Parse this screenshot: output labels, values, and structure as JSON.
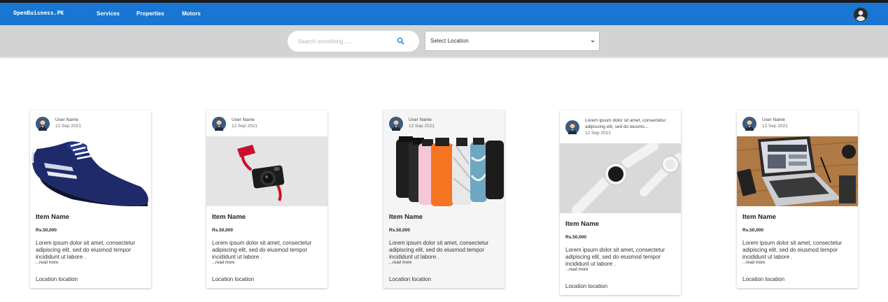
{
  "navbar": {
    "brand": "OpenBuisness.PK",
    "links": [
      "Services",
      "Properties",
      "Motors"
    ]
  },
  "search": {
    "placeholder": "Search something......",
    "location_placeholder": "Select Location"
  },
  "cards": [
    {
      "user": "User Name",
      "date": "12 Sep 2021",
      "image": "shoe",
      "title": "Item Name",
      "price": "Rs.50,000",
      "description": "Lorem ipsum dolor sit amet, consectetur adipiscing elit, sed do eiusmod tempor incididunt ut labore .",
      "read_more": "...read more",
      "location": "Location location"
    },
    {
      "user": "User Name",
      "date": "12 Sep 2021",
      "image": "camera",
      "title": "Item Name",
      "price": "Rs.50,000",
      "description": "Lorem ipsum dolor sit amet, consectetur adipiscing elit, sed do eiusmod tempor incididunt ut labore .",
      "read_more": "...read more",
      "location": "Location location"
    },
    {
      "user": "User Name",
      "date": "12 Sep 2021",
      "image": "bottles",
      "title": "Item Name",
      "price": "Rs.50,000",
      "description": "Lorem ipsum dolor sit amet, consectetur adipiscing elit, sed do eiusmod tempor incididunt ut labore .",
      "read_more": "...read more",
      "location": "Location location"
    },
    {
      "user": "Lorem ipsum dolor sit amet, consectetur adipiscing elit, sed do eiusmo...",
      "date": "12 Sep 2021",
      "image": "watch",
      "title": "Item Name",
      "price": "Rs.50,000",
      "description": "Lorem ipsum dolor sit amet, consectetur adipiscing elit, sed do eiusmod tempor incididunt ut labore .",
      "read_more": "...read more",
      "location": "Location location"
    },
    {
      "user": "User Name",
      "date": "12 Sep 2021",
      "image": "laptop",
      "title": "Item Name",
      "price": "Rs.50,000",
      "description": "Lorem ipsum dolor sit amet, consectetur adipiscing elit, sed do eiusmod tempor incididunt ut labore .",
      "read_more": "...read more",
      "location": "Location location"
    }
  ],
  "icons": {
    "account": "account-circle-icon",
    "search": "search-icon",
    "dropdown": "chevron-down-icon",
    "avatar": "user-avatar-icon"
  },
  "colors": {
    "navbar": "#1976d2",
    "searchbar": "#d3d3d3"
  }
}
